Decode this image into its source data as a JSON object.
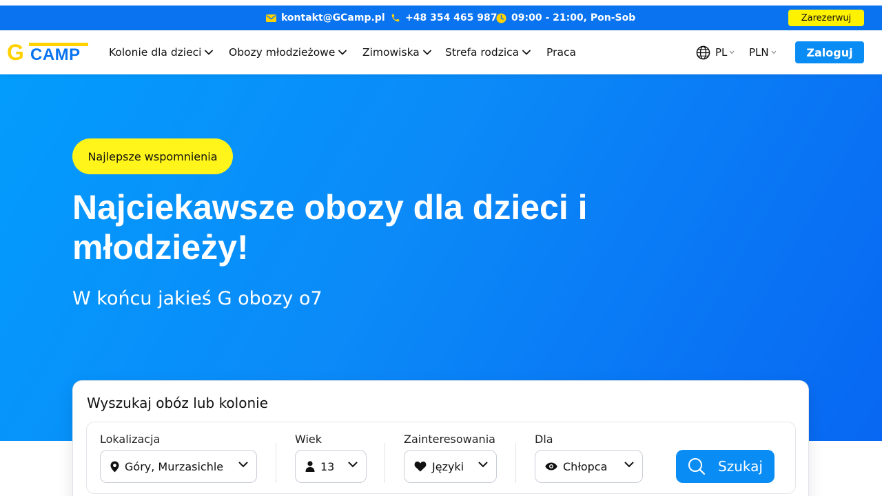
{
  "topbar": {
    "email": "kontakt@GCamp.pl",
    "phone": "+48 354 465 987",
    "hours": "09:00 - 21:00, Pon-Sob",
    "reserve_label": "Zarezerwuj"
  },
  "navbar": {
    "logo_g": "G",
    "logo_camp": "CAMP",
    "items": [
      {
        "label": "Kolonie dla dzieci",
        "has_dropdown": true
      },
      {
        "label": "Obozy młodzieżowe",
        "has_dropdown": true
      },
      {
        "label": "Zimowiska",
        "has_dropdown": true
      },
      {
        "label": "Strefa rodzica",
        "has_dropdown": true
      },
      {
        "label": "Praca",
        "has_dropdown": false
      }
    ],
    "language": "PL",
    "currency": "PLN",
    "login_label": "Zaloguj"
  },
  "hero": {
    "badge": "Najlepsze wspomnienia",
    "title": "Najciekawsze obozy dla dzieci i młodzieży!",
    "subtitle": "W końcu jakieś G obozy o7"
  },
  "search": {
    "title": "Wyszukaj obóz lub kolonie",
    "fields": {
      "location": {
        "label": "Lokalizacja",
        "value": "Góry, Murzasichle",
        "icon": "map-pin-icon"
      },
      "age": {
        "label": "Wiek",
        "value": "13",
        "icon": "person-icon"
      },
      "interests": {
        "label": "Zainteresowania",
        "value": "Języki",
        "icon": "heart-icon"
      },
      "for": {
        "label": "Dla",
        "value": "Chłopca",
        "icon": "eye-icon"
      }
    },
    "button_label": "Szukaj"
  },
  "colors": {
    "brand_blue": "#0a73f0",
    "accent_yellow": "#fff51a",
    "button_blue": "#0a8cf5"
  }
}
